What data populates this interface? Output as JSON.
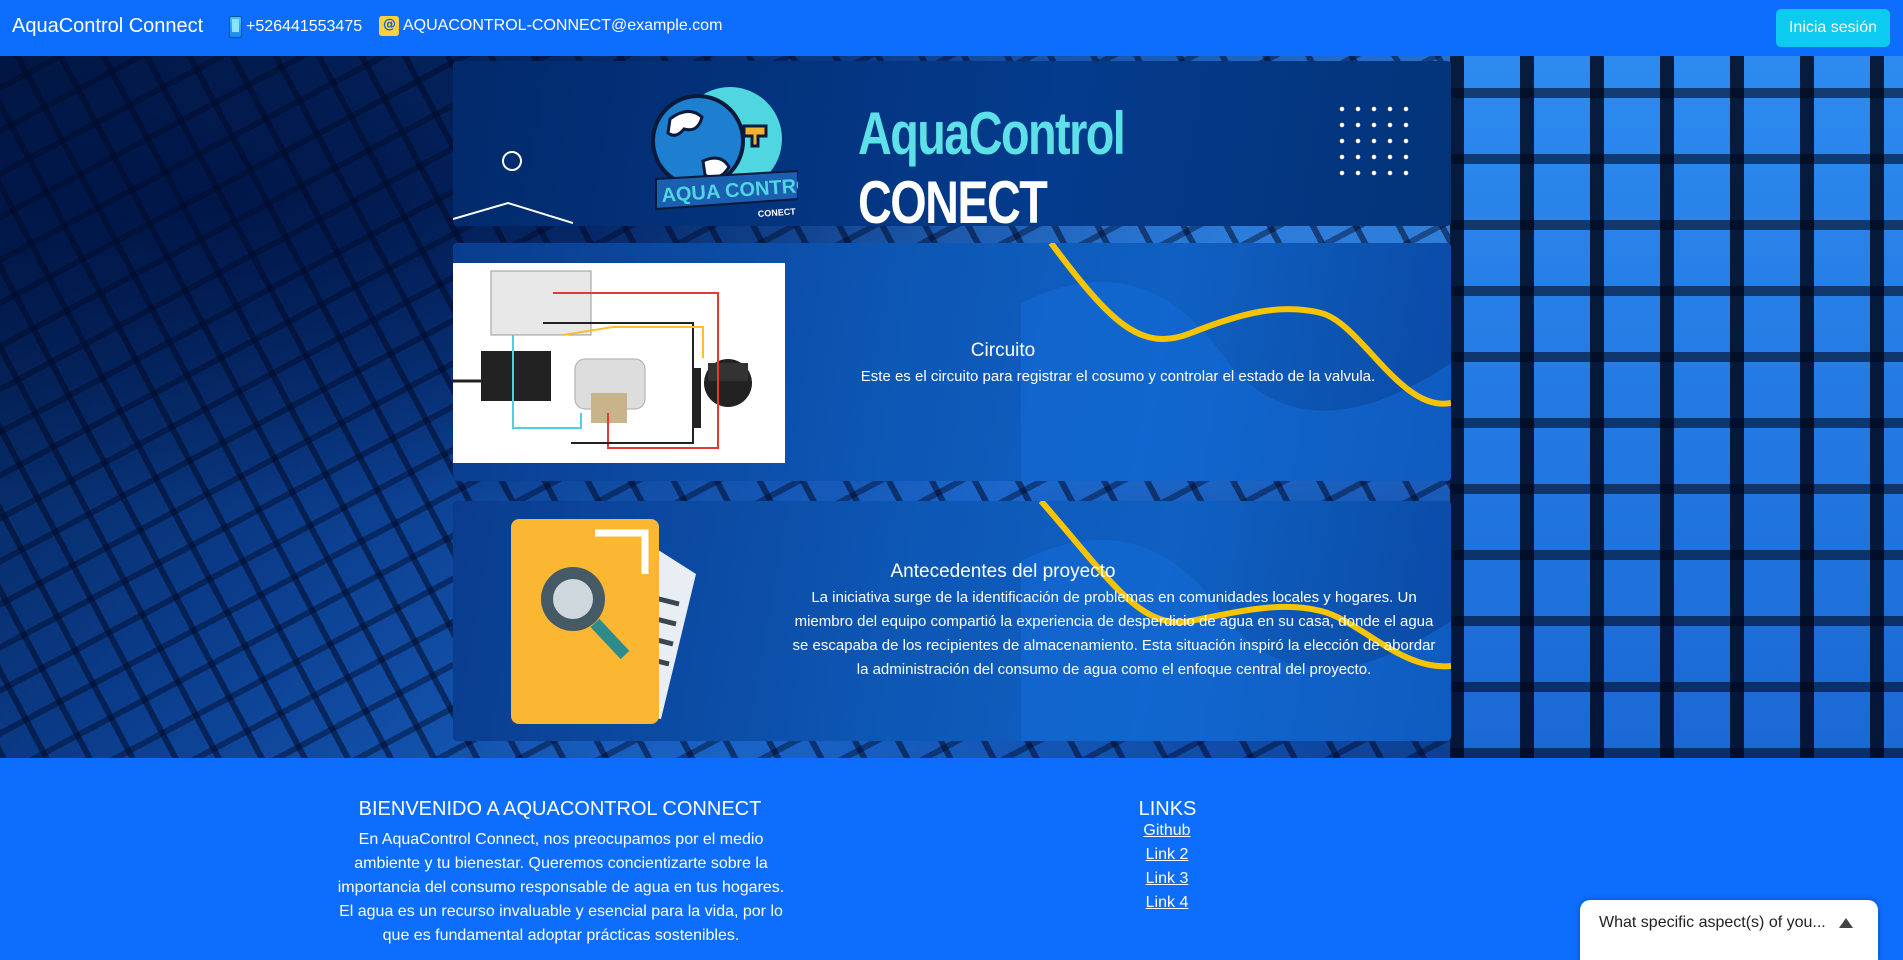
{
  "navbar": {
    "brand": "AquaControl Connect",
    "phone": "+526441553475",
    "email": "AQUACONTROL-CONNECT@example.com",
    "login_label": "Inicia sesión"
  },
  "banner": {
    "logo_line1": "AQUA CONTROL",
    "logo_line2": "CONECT",
    "title_aqua": "AquaControl",
    "title_conect": "CONECT"
  },
  "cards": [
    {
      "title": "Circuito",
      "text": "Este es el circuito para registrar el cosumo y controlar el estado de la valvula."
    },
    {
      "title": "Antecedentes del proyecto",
      "text": "La iniciativa surge de la identificación de problemas en comunidades locales y hogares. Un miembro del equipo compartió la experiencia de desperdicio de agua en su casa, donde el agua se escapaba de los recipientes de almacenamiento. Esta situación inspiró la elección de abordar la administración del consumo de agua como el enfoque central del proyecto."
    }
  ],
  "footer": {
    "title": "BIENVENIDO A AQUACONTROL CONNECT",
    "text": "En AquaControl Connect, nos preocupamos por el medio ambiente y tu bienestar. Queremos concientizarte sobre la importancia del consumo responsable de agua en tus hogares. El agua es un recurso invaluable y esencial para la vida, por lo que es fundamental adoptar prácticas sostenibles.",
    "links_title": "LINKS",
    "links": [
      "Github",
      "Link 2",
      "Link 3",
      "Link 4"
    ]
  },
  "chat_widget": {
    "text": "What specific aspect(s) of you..."
  },
  "colors": {
    "primary": "#0d6efd",
    "login_button": "#0dcaf0",
    "wave": "#f7c400",
    "banner_accent": "#5ee0e8"
  },
  "icons": [
    "phone-icon",
    "email-icon",
    "chevron-up-icon"
  ]
}
